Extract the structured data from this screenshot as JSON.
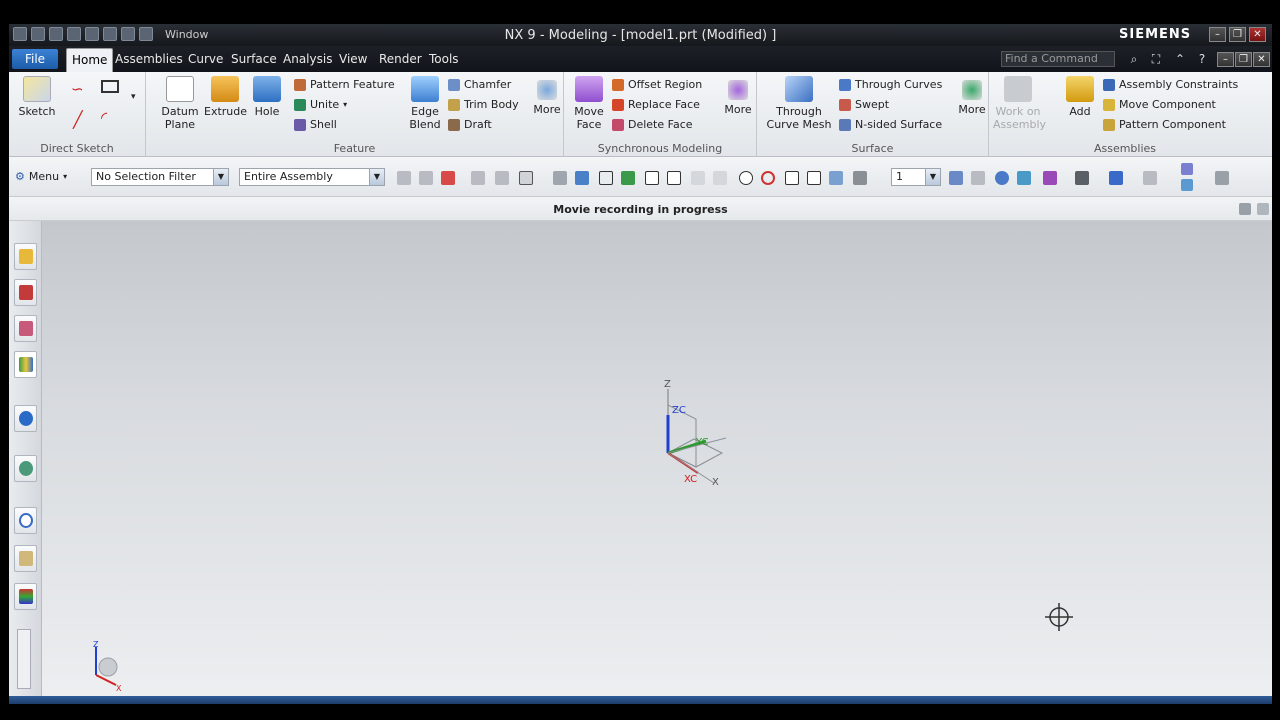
{
  "titlebar": {
    "window_menu": "Window",
    "title": "NX 9 - Modeling - [model1.prt (Modified) ]",
    "brand": "SIEMENS"
  },
  "menu": {
    "file": "File",
    "tabs": [
      "Home",
      "Assemblies",
      "Curve",
      "Surface",
      "Analysis",
      "View",
      "Render",
      "Tools"
    ],
    "find_placeholder": "Find a Command"
  },
  "ribbon": {
    "direct_sketch": {
      "label": "Direct Sketch",
      "sketch": "Sketch"
    },
    "feature": {
      "label": "Feature",
      "datum_plane": "Datum Plane",
      "extrude": "Extrude",
      "hole": "Hole",
      "pattern_feature": "Pattern Feature",
      "unite": "Unite",
      "shell": "Shell",
      "edge_blend": "Edge Blend",
      "chamfer": "Chamfer",
      "trim_body": "Trim Body",
      "draft": "Draft",
      "more": "More"
    },
    "sync": {
      "label": "Synchronous Modeling",
      "move_face": "Move Face",
      "offset_region": "Offset Region",
      "replace_face": "Replace Face",
      "delete_face": "Delete Face",
      "more": "More"
    },
    "surface": {
      "label": "Surface",
      "through_curve_mesh": "Through Curve Mesh",
      "through_curves": "Through Curves",
      "swept": "Swept",
      "n_sided": "N-sided Surface",
      "more": "More"
    },
    "assemblies": {
      "label": "Assemblies",
      "work_on": "Work on Assembly",
      "add": "Add",
      "constraints": "Assembly Constraints",
      "move_component": "Move Component",
      "pattern_component": "Pattern Component"
    }
  },
  "toolbar": {
    "menu": "Menu",
    "selection_filter": "No Selection Filter",
    "scope": "Entire Assembly",
    "layer": "1"
  },
  "status": {
    "message": "Movie recording in progress"
  },
  "triad": {
    "z": "Z",
    "zc": "ZC",
    "y": "Y",
    "yc": "YC",
    "x": "X",
    "xc": "XC"
  },
  "mini_triad": {
    "z": "Z",
    "x": "X"
  },
  "colors": {
    "accent": "#1c5cab",
    "x_axis": "#d02020",
    "y_axis": "#2a9a2a",
    "z_axis": "#1f3fd0"
  }
}
